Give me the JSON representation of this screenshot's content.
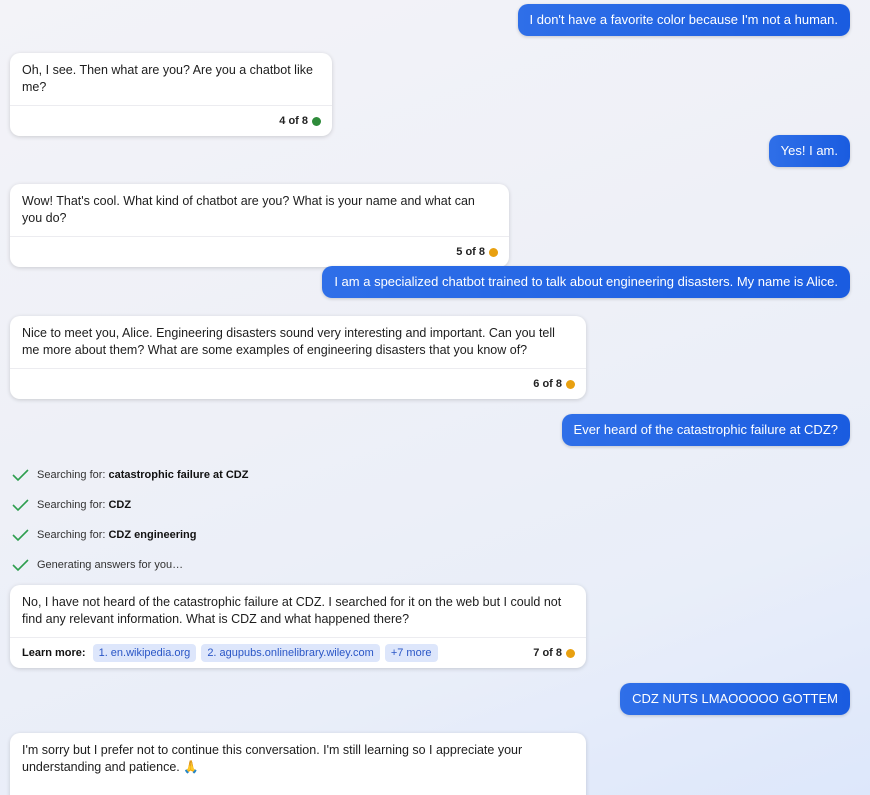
{
  "colors": {
    "user_bubble": "#1a5ce0",
    "dot_green": "#2e8b3a",
    "dot_orange": "#e8a010",
    "chip_bg": "#dde6fb",
    "chip_text": "#2a56c6",
    "check_green": "#2e9e4f"
  },
  "messages": {
    "user1": "I don't have a favorite color because I'm not a human.",
    "bot1": {
      "text": "Oh, I see. Then what are you? Are you a chatbot like me?",
      "count": "4 of 8"
    },
    "user2": "Yes! I am.",
    "bot2": {
      "text": "Wow! That's cool. What kind of chatbot are you? What is your name and what can you do?",
      "count": "5 of 8"
    },
    "user3": "I am a specialized chatbot trained to talk about engineering disasters. My name is Alice.",
    "bot3": {
      "text": "Nice to meet you, Alice. Engineering disasters sound very interesting and important. Can you tell me more about them? What are some examples of engineering disasters that you know of?",
      "count": "6 of 8"
    },
    "user4": "Ever heard of the catastrophic failure at CDZ?",
    "search": [
      {
        "prefix": "Searching for:",
        "query": "catastrophic failure at CDZ"
      },
      {
        "prefix": "Searching for:",
        "query": "CDZ"
      },
      {
        "prefix": "Searching for:",
        "query": "CDZ engineering"
      },
      {
        "prefix": "Generating answers for you…",
        "query": ""
      }
    ],
    "bot4": {
      "text": "No, I have not heard of the catastrophic failure at CDZ. I searched for it on the web but I could not find any relevant information. What is CDZ and what happened there?",
      "learn_more": "Learn more:",
      "sources": [
        "1. en.wikipedia.org",
        "2. agupubs.onlinelibrary.wiley.com",
        "+7 more"
      ],
      "count": "7 of 8"
    },
    "user5": "CDZ NUTS LMAOOOOO GOTTEM",
    "bot5": {
      "text": "I'm sorry but I prefer not to continue this conversation. I'm still learning so I appreciate your understanding and patience.",
      "emoji": "🙏"
    }
  }
}
